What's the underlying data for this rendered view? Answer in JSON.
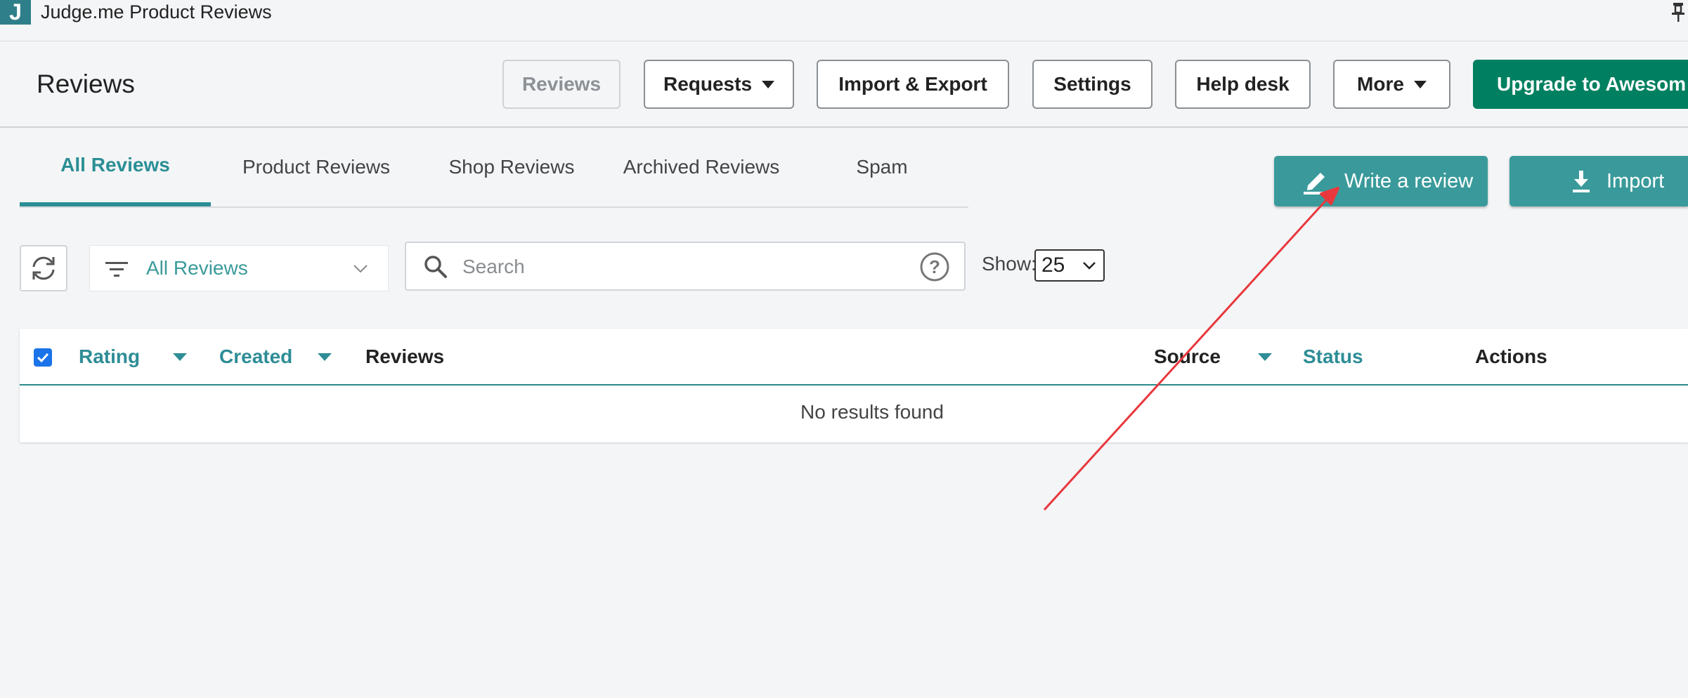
{
  "app": {
    "logo_letter": "J",
    "title": "Judge.me Product Reviews"
  },
  "header": {
    "page_title": "Reviews",
    "buttons": {
      "reviews": "Reviews",
      "requests": "Requests",
      "import_export": "Import & Export",
      "settings": "Settings",
      "help_desk": "Help desk",
      "more": "More",
      "upgrade": "Upgrade to Awesome"
    }
  },
  "tabs": [
    "All Reviews",
    "Product Reviews",
    "Shop Reviews",
    "Archived Reviews",
    "Spam"
  ],
  "actions": {
    "write_review": "Write a review",
    "import": "Import"
  },
  "filters": {
    "filter_value": "All Reviews",
    "search_placeholder": "Search",
    "show_label": "Show:",
    "show_value": "25"
  },
  "table": {
    "headers": [
      "Rating",
      "Created",
      "Reviews",
      "Source",
      "Status",
      "Actions"
    ],
    "empty_message": "No results found"
  },
  "colors": {
    "primary": "#008060",
    "teal": "#3a9a9b",
    "tab_active": "#2a8f95",
    "annotation": "#e8383d"
  }
}
